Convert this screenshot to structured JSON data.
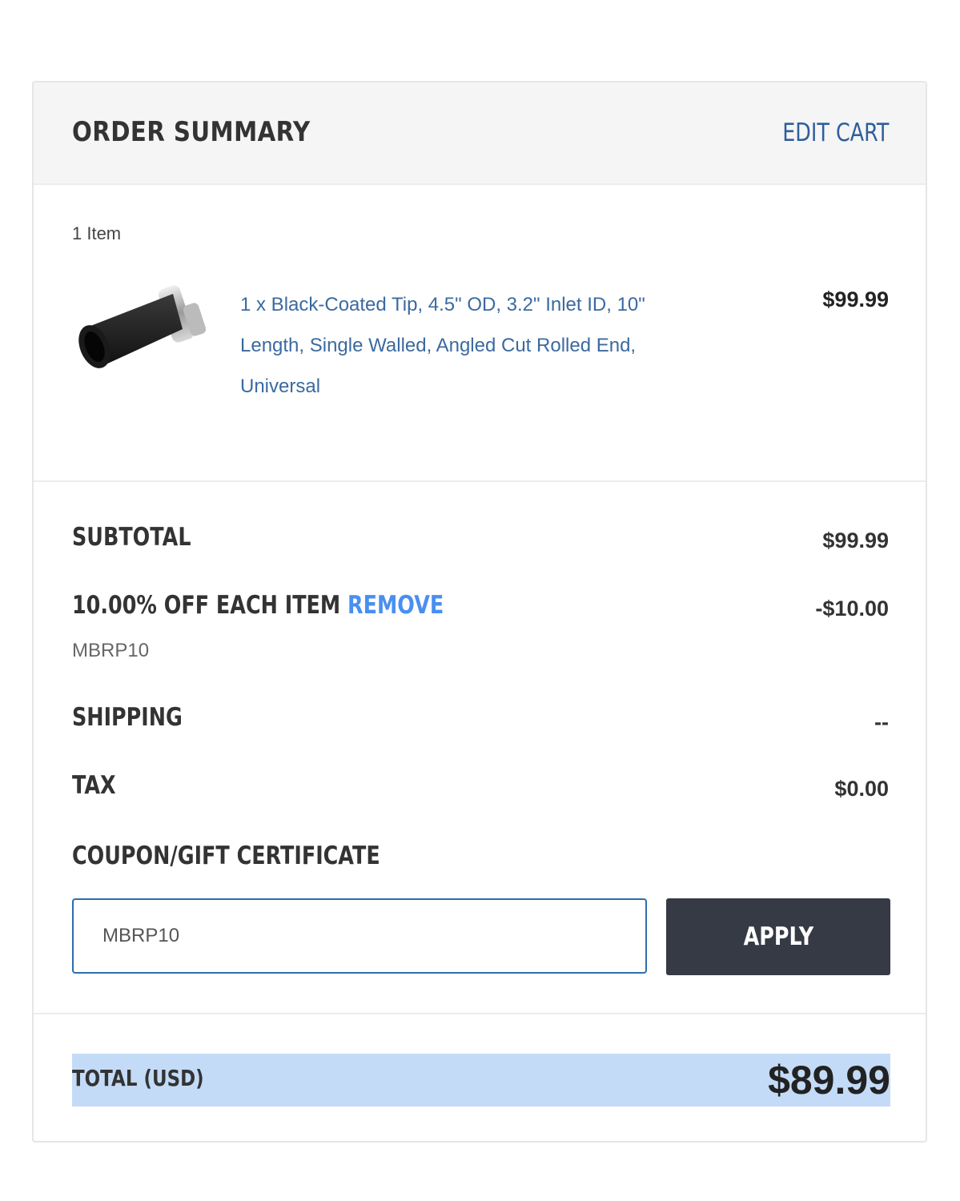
{
  "header": {
    "title": "ORDER SUMMARY",
    "edit_cart": "EDIT CART"
  },
  "cart": {
    "item_count": "1 Item",
    "item": {
      "name": "1 x Black-Coated Tip, 4.5\" OD, 3.2\" Inlet ID, 10\" Length, Single Walled, Angled Cut Rolled End, Universal",
      "price": "$99.99",
      "image_icon": "exhaust-tip-image"
    }
  },
  "summary": {
    "subtotal_label": "SUBTOTAL",
    "subtotal_value": "$99.99",
    "discount_label": "10.00% OFF EACH ITEM",
    "discount_remove": "REMOVE",
    "discount_value": "-$10.00",
    "discount_code": "MBRP10",
    "shipping_label": "SHIPPING",
    "shipping_value": "--",
    "tax_label": "TAX",
    "tax_value": "$0.00"
  },
  "coupon": {
    "label": "COUPON/GIFT CERTIFICATE",
    "input_value": "MBRP10",
    "apply_label": "APPLY"
  },
  "total": {
    "label": "TOTAL (USD)",
    "value": "$89.99"
  },
  "colors": {
    "link": "#2e5f9a",
    "remove_link": "#4a8ff0",
    "apply_button": "#363a45",
    "total_highlight": "#c3dbf7",
    "input_border": "#2e6db0"
  }
}
